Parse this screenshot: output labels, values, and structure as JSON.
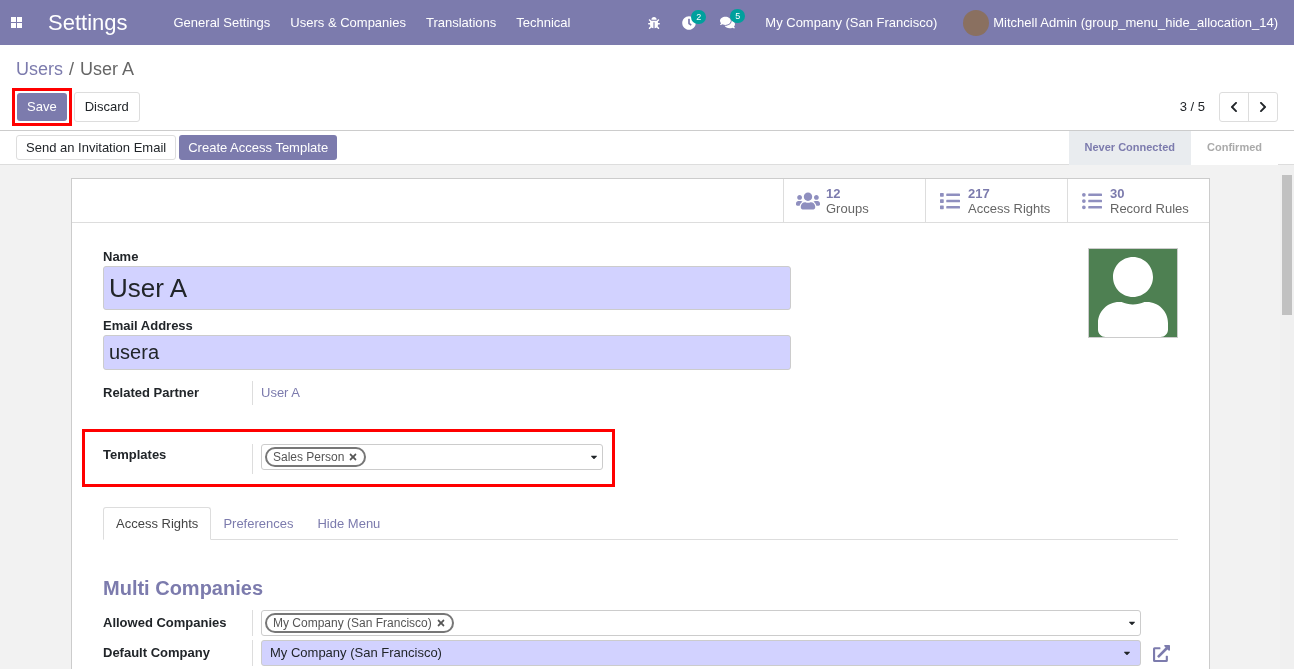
{
  "navbar": {
    "app_name": "Settings",
    "menu": [
      "General Settings",
      "Users & Companies",
      "Translations",
      "Technical"
    ],
    "activity_count": "2",
    "message_count": "5",
    "company": "My Company (San Francisco)",
    "user": "Mitchell Admin (group_menu_hide_allocation_14)"
  },
  "breadcrumb": [
    "Users",
    "/",
    "User A"
  ],
  "buttons": [
    "Save",
    "Discard"
  ],
  "pager": "3 / 5",
  "header_buttons": [
    {
      "label": "Send an Invitation Email",
      "kind": "secondary"
    },
    {
      "label": "Create Access Template",
      "kind": "primary"
    }
  ],
  "status_stages": [
    {
      "label": "Never Connected",
      "selected": true
    },
    {
      "label": "Confirmed",
      "selected": false
    }
  ],
  "stat_buttons": [
    {
      "value": "12",
      "label": "Groups"
    },
    {
      "value": "217",
      "label": "Access Rights"
    },
    {
      "value": "30",
      "label": "Record Rules"
    }
  ],
  "form": {
    "name_label": "Name",
    "name": "User A",
    "email_label": "Email Address",
    "email": "usera",
    "partner_label": "Related Partner",
    "partner": "User A",
    "templates_label": "Templates",
    "templates": [
      "Sales Person"
    ]
  },
  "tabs": [
    {
      "label": "Access Rights",
      "selected": true
    },
    {
      "label": "Preferences",
      "selected": false
    },
    {
      "label": "Hide Menu",
      "selected": false
    }
  ],
  "multi_companies": {
    "title": "Multi Companies",
    "allowed_label": "Allowed Companies",
    "allowed": [
      "My Company (San Francisco)"
    ],
    "default_label": "Default Company",
    "default": "My Company (San Francisco)"
  }
}
